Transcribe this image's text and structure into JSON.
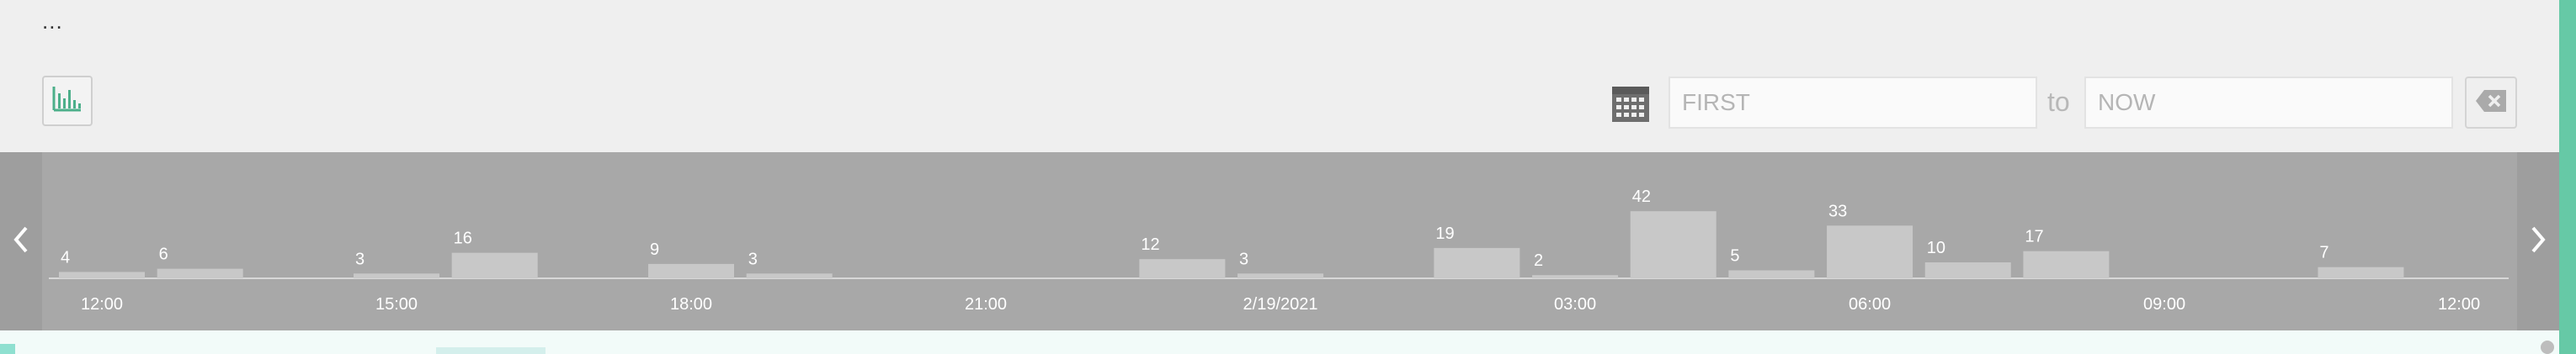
{
  "toolbar": {
    "menu_glyph": "...",
    "histogram_toggle_icon": "bar-chart-icon",
    "calendar_icon": "calendar-icon",
    "from_placeholder": "FIRST",
    "to_label": "to",
    "until_placeholder": "NOW",
    "clear_icon": "backspace-icon"
  },
  "histogram": {
    "prev_icon": "chevron-left-icon",
    "next_icon": "chevron-right-icon"
  },
  "chart_data": {
    "type": "bar",
    "x": [
      "12:00",
      "13:00",
      "14:00",
      "15:00",
      "16:00",
      "17:00",
      "18:00",
      "19:00",
      "20:00",
      "21:00",
      "22:00",
      "23:00",
      "2/19/2021",
      "01:00",
      "02:00",
      "03:00",
      "04:00",
      "05:00",
      "06:00",
      "07:00",
      "08:00",
      "09:00",
      "10:00",
      "11:00",
      "12:00"
    ],
    "values": [
      4,
      6,
      null,
      3,
      16,
      null,
      9,
      3,
      null,
      null,
      null,
      12,
      3,
      null,
      19,
      2,
      42,
      5,
      33,
      10,
      17,
      null,
      null,
      7,
      null
    ],
    "tick_labels": [
      "12:00",
      "15:00",
      "18:00",
      "21:00",
      "2/19/2021",
      "03:00",
      "06:00",
      "09:00",
      "12:00"
    ],
    "grid": false,
    "legend": "none"
  },
  "colors": {
    "accent": "#66c9a6",
    "bar": "#c8c8c8",
    "band": "#a8a8a8"
  }
}
